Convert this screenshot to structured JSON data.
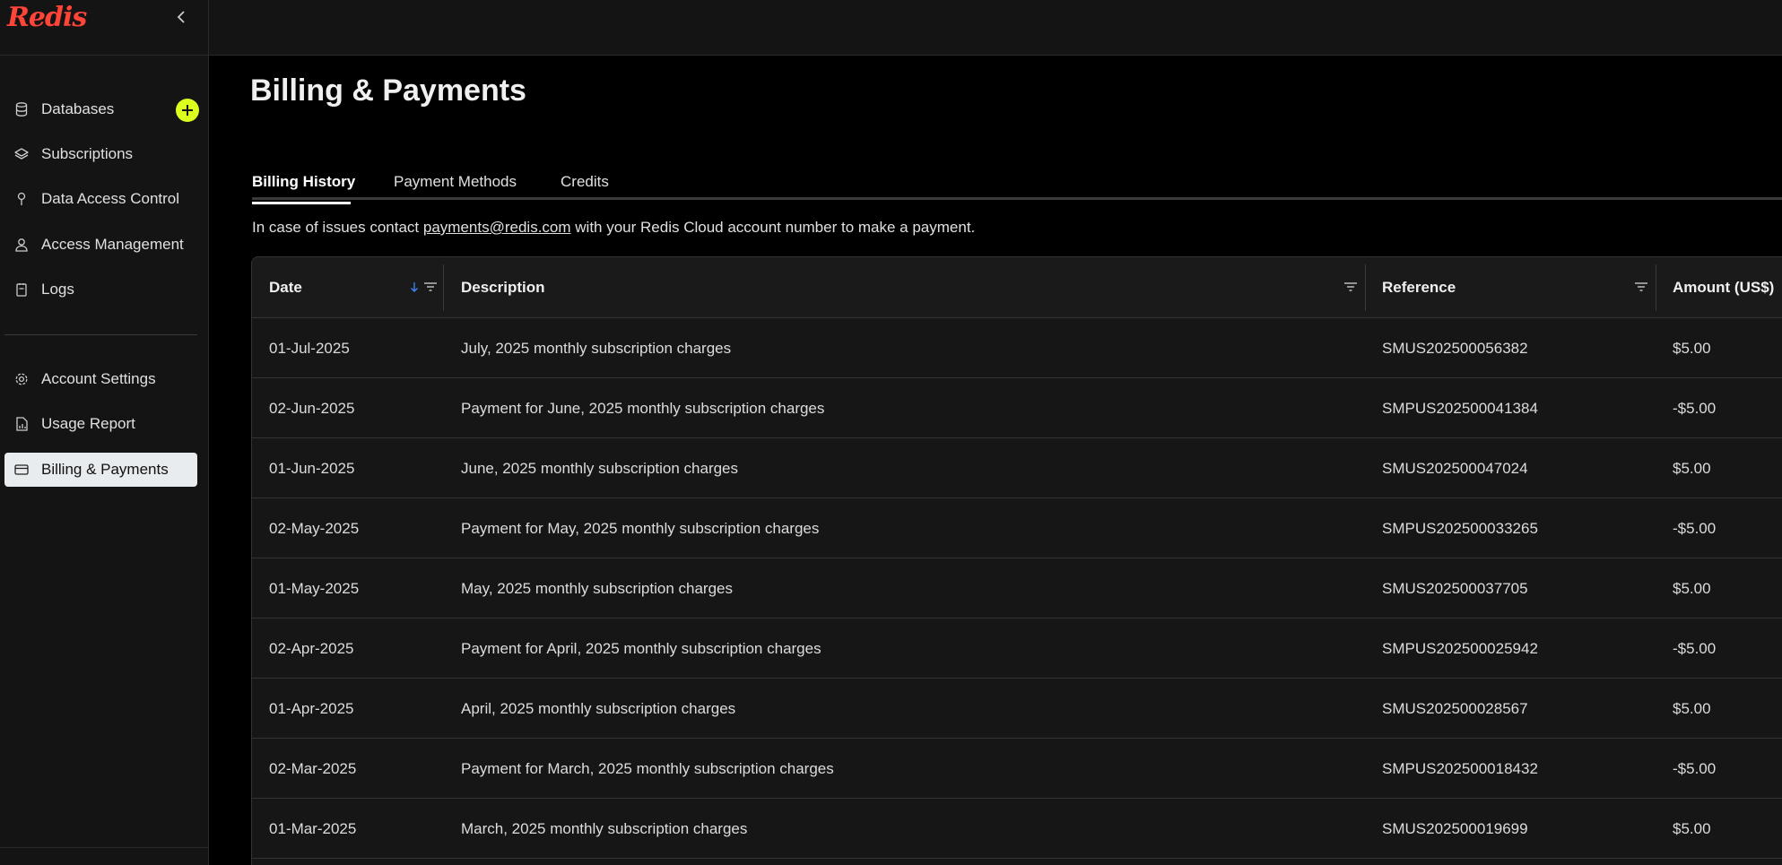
{
  "brand": {
    "logo_text": "Redis",
    "accent": "#ff4438",
    "add_color": "#dcff1e"
  },
  "sidebar": {
    "items": [
      {
        "label": "Databases",
        "icon": "database-icon"
      },
      {
        "label": "Subscriptions",
        "icon": "layers-icon"
      },
      {
        "label": "Data Access Control",
        "icon": "key-icon"
      },
      {
        "label": "Access Management",
        "icon": "user-icon"
      },
      {
        "label": "Logs",
        "icon": "log-icon"
      },
      {
        "label": "Account Settings",
        "icon": "gear-icon"
      },
      {
        "label": "Usage Report",
        "icon": "report-icon"
      },
      {
        "label": "Billing & Payments",
        "icon": "card-icon",
        "active": true
      }
    ]
  },
  "page": {
    "title": "Billing & Payments",
    "tabs": [
      {
        "label": "Billing History",
        "active": true
      },
      {
        "label": "Payment Methods"
      },
      {
        "label": "Credits"
      }
    ],
    "notice": {
      "before": "In case of issues contact ",
      "email": "payments@redis.com",
      "after": " with your Redis Cloud account number to make a payment."
    }
  },
  "table": {
    "columns": [
      "Date",
      "Description",
      "Reference",
      "Amount (US$)"
    ],
    "sort": {
      "column": "Date",
      "direction": "descending"
    },
    "rows": [
      [
        "01-Jul-2025",
        "July, 2025 monthly subscription charges",
        "SMUS202500056382",
        "$5.00"
      ],
      [
        "02-Jun-2025",
        "Payment for June, 2025 monthly subscription charges",
        "SMPUS202500041384",
        "-$5.00"
      ],
      [
        "01-Jun-2025",
        "June, 2025 monthly subscription charges",
        "SMUS202500047024",
        "$5.00"
      ],
      [
        "02-May-2025",
        "Payment for May, 2025 monthly subscription charges",
        "SMPUS202500033265",
        "-$5.00"
      ],
      [
        "01-May-2025",
        "May, 2025 monthly subscription charges",
        "SMUS202500037705",
        "$5.00"
      ],
      [
        "02-Apr-2025",
        "Payment for April, 2025 monthly subscription charges",
        "SMPUS202500025942",
        "-$5.00"
      ],
      [
        "01-Apr-2025",
        "April, 2025 monthly subscription charges",
        "SMUS202500028567",
        "$5.00"
      ],
      [
        "02-Mar-2025",
        "Payment for March, 2025 monthly subscription charges",
        "SMPUS202500018432",
        "-$5.00"
      ],
      [
        "01-Mar-2025",
        "March, 2025 monthly subscription charges",
        "SMUS202500019699",
        "$5.00"
      ]
    ]
  }
}
